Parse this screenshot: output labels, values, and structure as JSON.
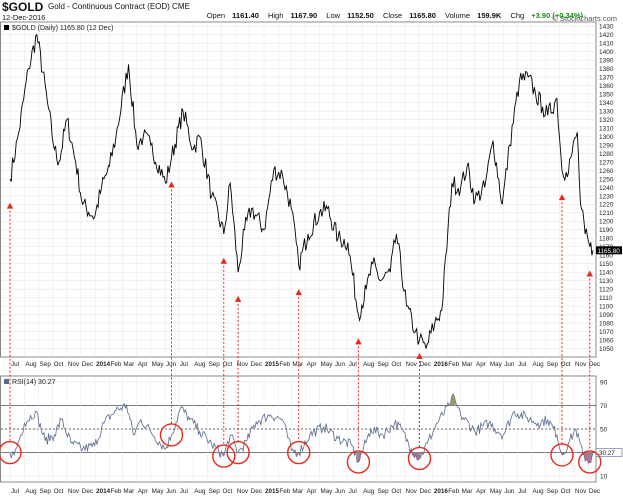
{
  "header": {
    "symbol": "$GOLD",
    "description": "Gold - Continuous Contract (EOD)  CME",
    "date": "12-Dec-2016",
    "watermark": "© StockCharts.com",
    "open_label": "Open",
    "open": "1161.40",
    "high_label": "High",
    "high": "1167.90",
    "low_label": "Low",
    "low": "1152.50",
    "close_label": "Close",
    "close": "1165.80",
    "volume_label": "Volume",
    "volume": "159.9K",
    "chg_label": "Chg",
    "chg": "+3.90 (+0.34%)"
  },
  "colors": {
    "price_line": "#000000",
    "rsi_line": "#5a6c8c",
    "overbought_fill": "#8a8a4a",
    "oversold_fill": "#9a6080",
    "annotation": "#e8281c",
    "grid": "#e6e6e6",
    "last_price_badge": "#000000"
  },
  "chart_data": [
    {
      "type": "line",
      "title": "$GOLD (Daily) 1165.80 (12 Dec)",
      "legend": "$GOLD (Daily) 1165.80 (12 Dec)",
      "legend_position": "top-left",
      "y_axis": "right",
      "ylim": [
        1040,
        1435
      ],
      "yticks": [
        1050,
        1060,
        1070,
        1080,
        1090,
        1100,
        1110,
        1120,
        1130,
        1140,
        1150,
        1160,
        1170,
        1180,
        1190,
        1200,
        1210,
        1220,
        1230,
        1240,
        1250,
        1260,
        1270,
        1280,
        1290,
        1300,
        1310,
        1320,
        1330,
        1340,
        1350,
        1360,
        1370,
        1380,
        1390,
        1400,
        1410,
        1420,
        1430
      ],
      "last_value_label": "1165.80",
      "grid": true,
      "x": [
        "2013-07-01",
        "2013-07-20",
        "2013-08-10",
        "2013-08-28",
        "2013-09-20",
        "2013-10-05",
        "2013-10-15",
        "2013-11-01",
        "2013-11-20",
        "2013-12-05",
        "2013-12-31",
        "2014-01-15",
        "2014-02-01",
        "2014-02-15",
        "2014-03-14",
        "2014-04-01",
        "2014-04-15",
        "2014-05-01",
        "2014-06-02",
        "2014-06-15",
        "2014-07-10",
        "2014-08-01",
        "2014-08-15",
        "2014-09-10",
        "2014-10-06",
        "2014-10-20",
        "2014-11-06",
        "2014-11-20",
        "2014-12-05",
        "2015-01-01",
        "2015-01-22",
        "2015-02-10",
        "2015-03-01",
        "2015-03-17",
        "2015-04-06",
        "2015-05-01",
        "2015-05-18",
        "2015-06-10",
        "2015-07-01",
        "2015-07-24",
        "2015-08-10",
        "2015-08-24",
        "2015-09-10",
        "2015-10-01",
        "2015-10-14",
        "2015-11-05",
        "2015-11-24",
        "2015-12-03",
        "2015-12-17",
        "2016-01-05",
        "2016-01-20",
        "2016-02-11",
        "2016-03-01",
        "2016-03-15",
        "2016-04-01",
        "2016-04-22",
        "2016-05-10",
        "2016-05-30",
        "2016-06-15",
        "2016-07-06",
        "2016-07-25",
        "2016-08-10",
        "2016-08-25",
        "2016-09-05",
        "2016-09-25",
        "2016-10-06",
        "2016-10-15",
        "2016-10-25",
        "2016-11-08",
        "2016-11-15",
        "2016-11-25",
        "2016-12-05",
        "2016-12-12"
      ],
      "y": [
        1250,
        1305,
        1380,
        1420,
        1340,
        1285,
        1270,
        1320,
        1270,
        1220,
        1205,
        1240,
        1265,
        1300,
        1385,
        1290,
        1300,
        1290,
        1245,
        1275,
        1330,
        1285,
        1300,
        1230,
        1185,
        1245,
        1140,
        1190,
        1215,
        1190,
        1260,
        1255,
        1215,
        1148,
        1185,
        1210,
        1215,
        1180,
        1175,
        1090,
        1120,
        1150,
        1130,
        1140,
        1185,
        1100,
        1070,
        1060,
        1050,
        1080,
        1095,
        1245,
        1240,
        1265,
        1225,
        1240,
        1295,
        1220,
        1290,
        1365,
        1370,
        1350,
        1335,
        1325,
        1345,
        1260,
        1258,
        1275,
        1305,
        1220,
        1185,
        1170,
        1165.8
      ],
      "x_tick_labels": [
        "Jul",
        "Aug",
        "Sep",
        "Oct",
        "Nov",
        "Dec",
        "2014",
        "Feb",
        "Mar",
        "Apr",
        "May",
        "Jun",
        "Jul",
        "Aug",
        "Sep",
        "Oct",
        "Nov",
        "Dec",
        "2015",
        "Feb",
        "Mar",
        "Apr",
        "May",
        "Jun",
        "Jul",
        "Aug",
        "Sep",
        "Oct",
        "Nov",
        "Dec",
        "2016",
        "Feb",
        "Mar",
        "Apr",
        "May",
        "Jun",
        "Jul",
        "Aug",
        "Sep",
        "Oct",
        "Nov",
        "Dec"
      ],
      "annotations": [
        "2013-07-01",
        "2014-06-15",
        "2014-10-06",
        "2014-11-06",
        "2015-03-17",
        "2015-07-24",
        "2015-12-03",
        "2016-10-06",
        "2016-12-05"
      ]
    },
    {
      "type": "line",
      "title": "RSI(14) 30.27",
      "legend": "RSI(14) 30.27",
      "legend_position": "top-left",
      "y_axis": "right",
      "ylim": [
        5,
        95
      ],
      "yticks": [
        10,
        30,
        50,
        70,
        90
      ],
      "reference_lines": [
        70,
        50,
        30
      ],
      "last_value_label": "30.27",
      "grid": true,
      "x": [
        "2013-07-01",
        "2013-07-10",
        "2013-08-01",
        "2013-08-25",
        "2013-09-15",
        "2013-10-05",
        "2013-10-20",
        "2013-11-10",
        "2013-12-05",
        "2013-12-31",
        "2014-01-20",
        "2014-02-15",
        "2014-03-10",
        "2014-03-25",
        "2014-04-10",
        "2014-05-01",
        "2014-06-02",
        "2014-06-15",
        "2014-07-05",
        "2014-07-25",
        "2014-08-15",
        "2014-09-10",
        "2014-10-06",
        "2014-10-20",
        "2014-11-06",
        "2014-11-25",
        "2014-12-15",
        "2015-01-15",
        "2015-02-10",
        "2015-03-01",
        "2015-03-17",
        "2015-04-10",
        "2015-05-10",
        "2015-06-10",
        "2015-07-10",
        "2015-07-24",
        "2015-08-20",
        "2015-09-15",
        "2015-10-10",
        "2015-10-25",
        "2015-11-15",
        "2015-12-03",
        "2015-12-20",
        "2016-01-10",
        "2016-02-05",
        "2016-02-11",
        "2016-03-01",
        "2016-04-01",
        "2016-05-01",
        "2016-06-01",
        "2016-06-25",
        "2016-07-20",
        "2016-08-15",
        "2016-09-05",
        "2016-09-25",
        "2016-10-06",
        "2016-10-20",
        "2016-11-05",
        "2016-11-20",
        "2016-12-05",
        "2016-12-12"
      ],
      "y": [
        30,
        28,
        55,
        65,
        40,
        45,
        58,
        38,
        33,
        36,
        55,
        66,
        70,
        45,
        58,
        48,
        33,
        45,
        68,
        58,
        48,
        37,
        27,
        45,
        30,
        40,
        56,
        62,
        58,
        32,
        30,
        45,
        52,
        42,
        36,
        22,
        50,
        45,
        55,
        50,
        33,
        25,
        38,
        55,
        70,
        78,
        62,
        48,
        55,
        45,
        65,
        60,
        55,
        58,
        45,
        28,
        38,
        50,
        28,
        22,
        30.27
      ],
      "x_tick_labels": [
        "Jul",
        "Aug",
        "Sep",
        "Oct",
        "Nov",
        "Dec",
        "2014",
        "Feb",
        "Mar",
        "Apr",
        "May",
        "Jun",
        "Jul",
        "Aug",
        "Sep",
        "Oct",
        "Nov",
        "Dec",
        "2015",
        "Feb",
        "Mar",
        "Apr",
        "May",
        "Jun",
        "Jul",
        "Aug",
        "Sep",
        "Oct",
        "Nov",
        "Dec",
        "2016",
        "Feb",
        "Mar",
        "Apr",
        "May",
        "Jun",
        "Jul",
        "Aug",
        "Sep",
        "Oct",
        "Nov",
        "Dec"
      ],
      "annotations": [
        "2013-07-01",
        "2014-06-15",
        "2014-10-06",
        "2014-11-06",
        "2015-03-17",
        "2015-07-24",
        "2015-12-03",
        "2016-10-06",
        "2016-12-05"
      ]
    }
  ]
}
